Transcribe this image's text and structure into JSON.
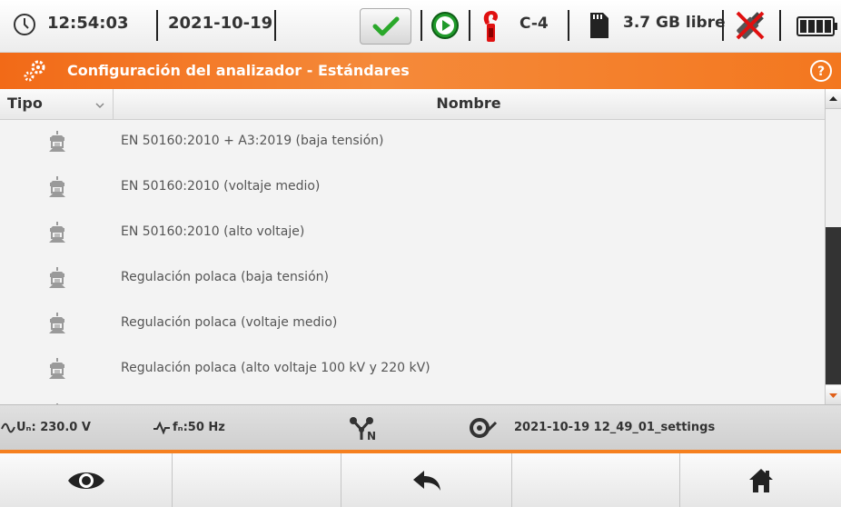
{
  "status_bar": {
    "time": "12:54:03",
    "date": "2021-10-19",
    "clamp": "C-4",
    "storage": "3.7 GB libre",
    "icons": [
      "clock-icon",
      "check-icon",
      "play-icon",
      "clamp-icon",
      "sd-card-icon",
      "usb-icon",
      "battery-icon"
    ]
  },
  "title_bar": {
    "title": "Configuración del analizador - Estándares",
    "icons": [
      "gears-icon",
      "help-icon"
    ]
  },
  "table": {
    "columns": [
      "Tipo",
      "Nombre"
    ],
    "rows": [
      {
        "type_icon": "standard-icon",
        "name": "EN 50160:2010 + A3:2019 (baja tensión)"
      },
      {
        "type_icon": "standard-icon",
        "name": "EN 50160:2010 (voltaje medio)"
      },
      {
        "type_icon": "standard-icon",
        "name": "EN 50160:2010 (alto voltaje)"
      },
      {
        "type_icon": "standard-icon",
        "name": "Regulación polaca (baja tensión)"
      },
      {
        "type_icon": "standard-icon",
        "name": "Regulación polaca (voltaje medio)"
      },
      {
        "type_icon": "standard-icon",
        "name": "Regulación polaca (alto voltaje 100 kV y 220 kV)"
      }
    ]
  },
  "info_bar": {
    "un": "Uₙ: 230.0 V",
    "fn": "fₙ:50 Hz",
    "settings_file": "2021-10-19 12_49_01_settings",
    "icons": [
      "sine-icon",
      "frequency-icon",
      "network-icon",
      "settings-file-icon"
    ]
  },
  "buttons": [
    {
      "name": "view-button",
      "icon": "eye-icon"
    },
    {
      "name": "empty-button-2",
      "icon": ""
    },
    {
      "name": "back-button",
      "icon": "back-arrow-icon"
    },
    {
      "name": "empty-button-4",
      "icon": ""
    },
    {
      "name": "home-button",
      "icon": "home-icon"
    }
  ],
  "colors": {
    "accent": "#f26a17",
    "check_green": "#2aa82a",
    "play_green": "#1f9a2a",
    "clamp_red": "#e01010"
  }
}
